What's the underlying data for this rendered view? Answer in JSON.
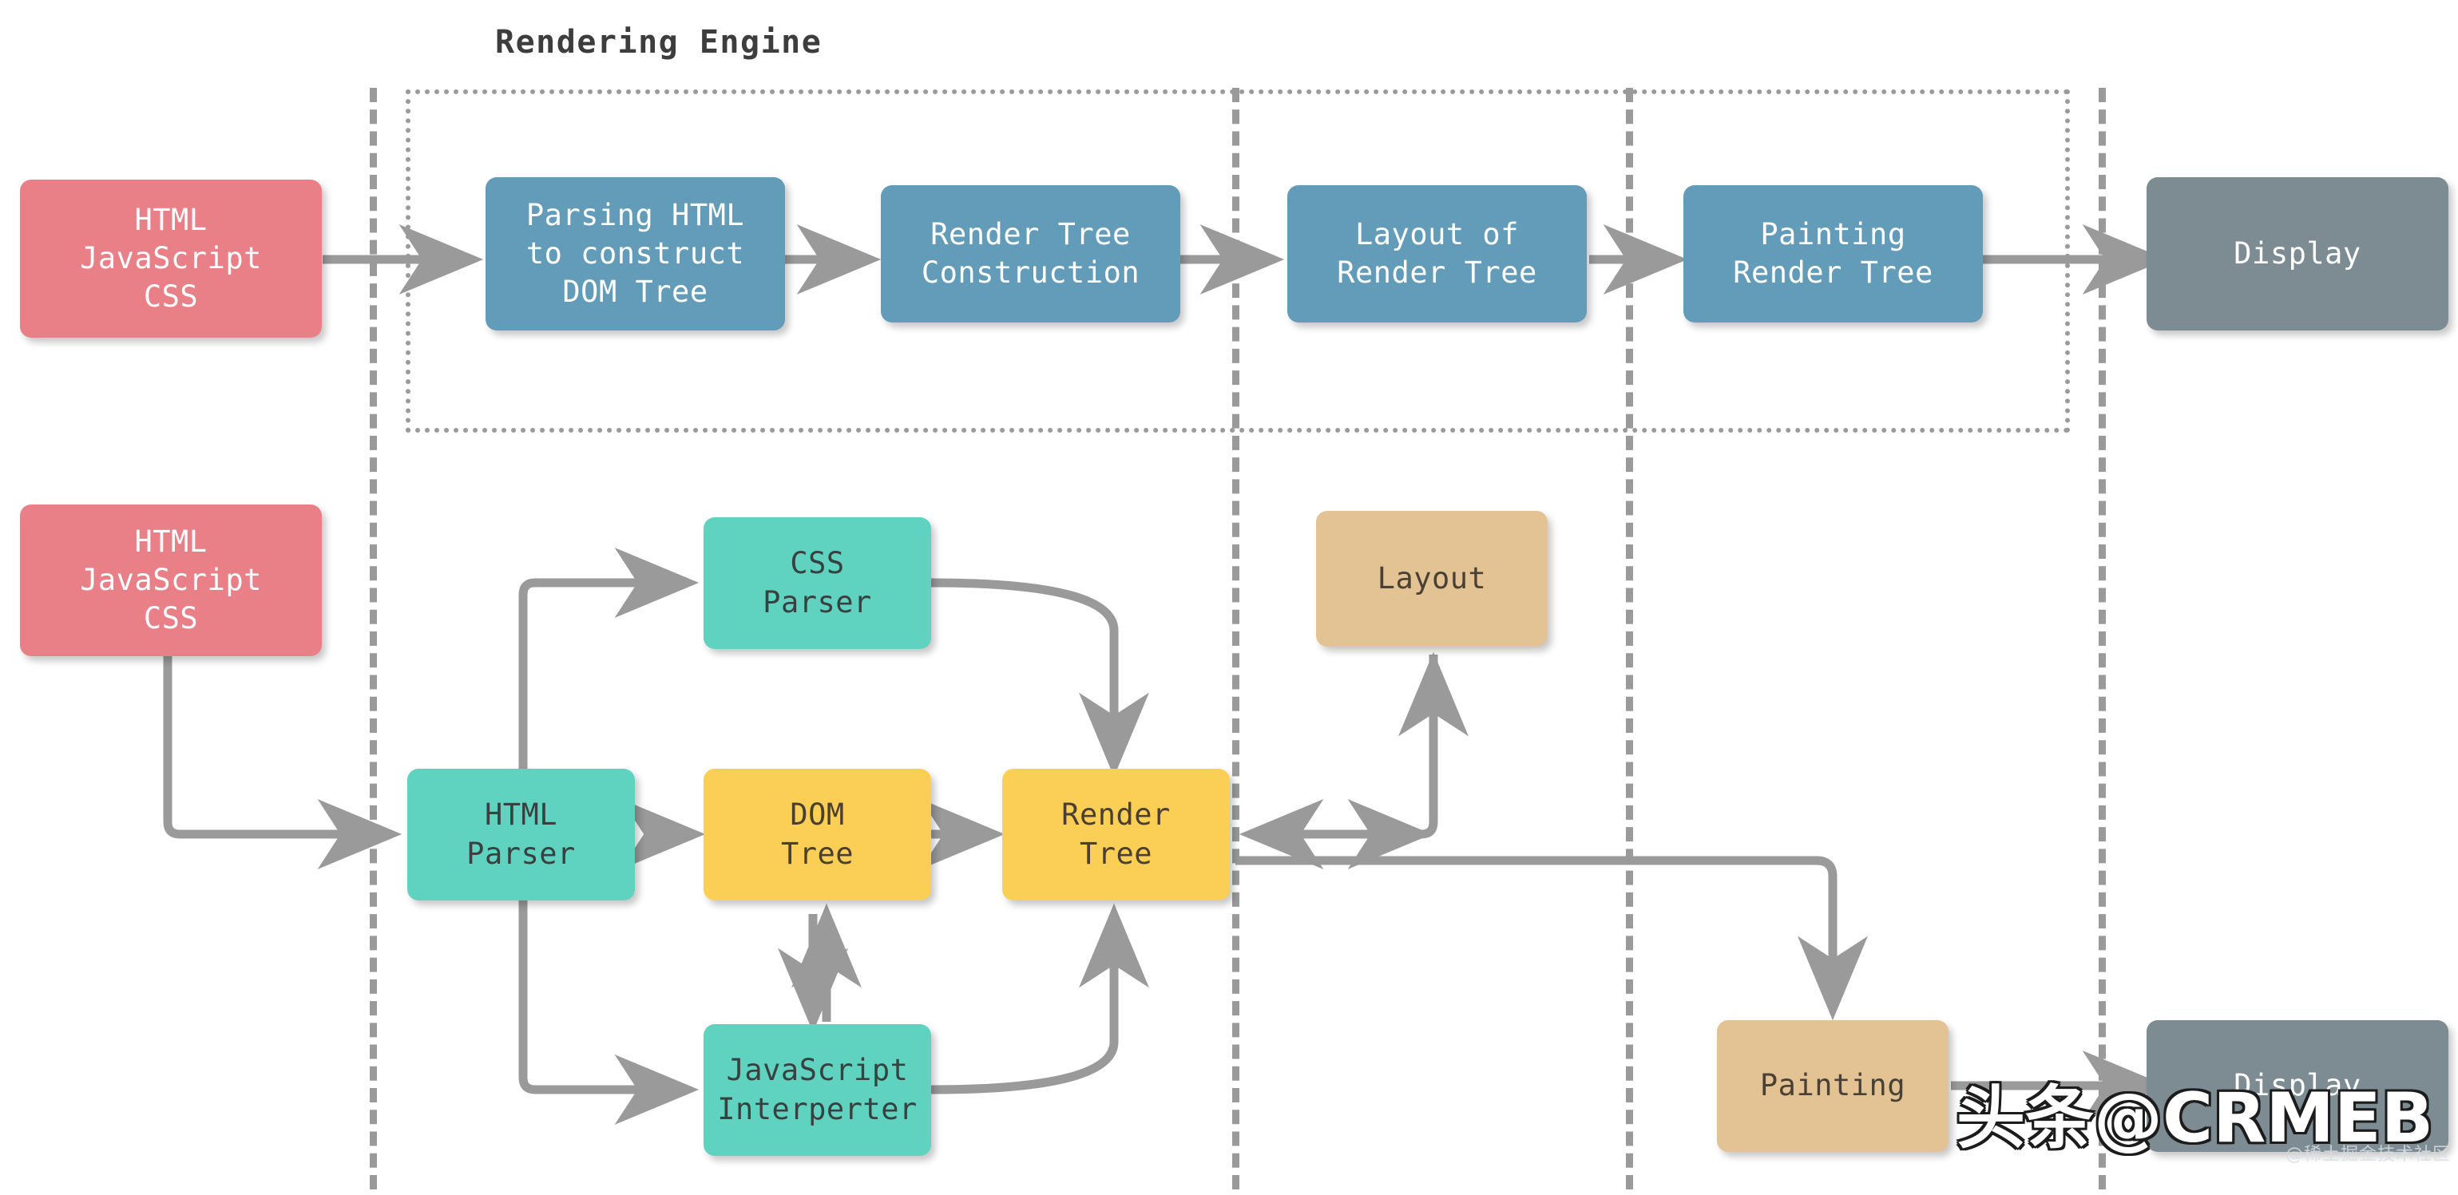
{
  "diagram": {
    "section_title": "Rendering Engine",
    "colors": {
      "pink": "#e98088",
      "blue": "#629cb9",
      "gray": "#7d8b93",
      "teal": "#5fd2c0",
      "yellow": "#fbcf55",
      "tan": "#e3c294",
      "connector": "#9a9a9a",
      "title_text": "#3d3d3d"
    },
    "top_row": {
      "input": "HTML\nJavaScript\nCSS",
      "parsing_html": "Parsing HTML\nto construct\nDOM Tree",
      "render_tree_construction": "Render Tree\nConstruction",
      "layout_of_render_tree": "Layout of\nRender Tree",
      "painting_render_tree": "Painting\nRender Tree",
      "display": "Display"
    },
    "bottom_row": {
      "input": "HTML\nJavaScript\nCSS",
      "css_parser": "CSS\nParser",
      "html_parser": "HTML\nParser",
      "dom_tree": "DOM\nTree",
      "render_tree": "Render\nTree",
      "javascript_interpreter": "JavaScript\nInterperter",
      "layout": "Layout",
      "painting": "Painting",
      "display": "Display"
    }
  },
  "watermark": {
    "main": "头条@CRMEB",
    "sub": "@稀土掘金技术社区"
  }
}
